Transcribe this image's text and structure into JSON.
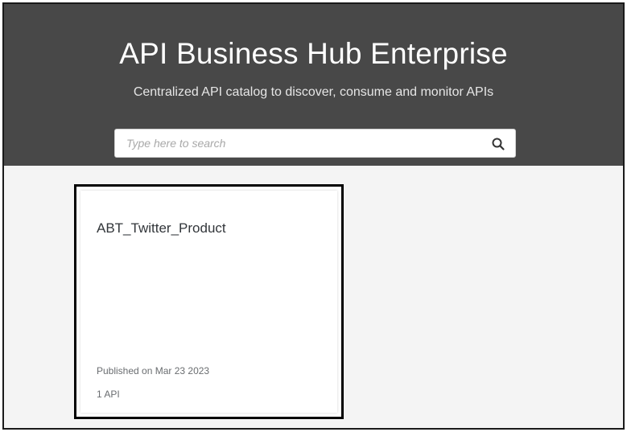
{
  "hero": {
    "title": "API Business Hub Enterprise",
    "subtitle": "Centralized API catalog to discover, consume and monitor APIs"
  },
  "search": {
    "placeholder": "Type here to search",
    "value": "",
    "icon": "search-icon"
  },
  "products": [
    {
      "title": "ABT_Twitter_Product",
      "published": "Published on Mar 23 2023",
      "api_count": "1 API"
    }
  ],
  "colors": {
    "hero_background": "#484848",
    "page_background": "#f4f4f4",
    "card_background": "#ffffff",
    "card_highlight_border": "#000000"
  }
}
